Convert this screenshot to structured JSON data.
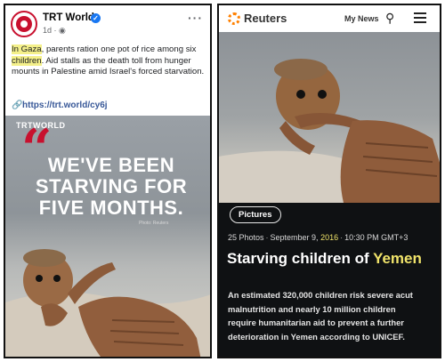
{
  "trt_post": {
    "page_name": "TRT World",
    "verified_icon": "verified-badge-icon",
    "meta": "1d · ",
    "meta_icon": "globe-icon",
    "text_hl1": "In Gaza",
    "text_1": ", parents ration one pot of rice among six",
    "text_hl2": "children",
    "text_2": ". Aid stalls as the death toll from hunger mounts in Palestine amid Israel's forced starvation.",
    "link": "https://trt.world/cy6j",
    "link_icon": "link-icon",
    "more_icon": "more-options-icon",
    "image": {
      "brand": "TRTWORLD",
      "headline_1": "WE'VE BEEN",
      "headline_2": "STARVING FOR",
      "headline_3": "FIVE MONTHS.",
      "credit": "Photo: Reuters",
      "accent": "#c8102e"
    }
  },
  "reuters": {
    "logo": "Reuters",
    "logo_icon": "reuters-logo-icon",
    "my_news": "My News",
    "search_icon": "search-icon",
    "menu_icon": "hamburger-menu-icon",
    "pictures_label": "Pictures",
    "meta_photos": "25 Photos",
    "meta_date": "September 9, ",
    "meta_year": "2016",
    "meta_time": "10:30 PM GMT+3",
    "title_1": "Starving children of ",
    "title_hl": "Yemen",
    "body_line_1": "An estimated 320,000 children risk severe acut",
    "body_line_2": "malnutrition and nearly 10 million children",
    "body_line_3": "require humanitarian aid to prevent a further",
    "body_line_4": "deterioration in Yemen according to UNICEF.",
    "highlight_color": "#f0e36a"
  }
}
